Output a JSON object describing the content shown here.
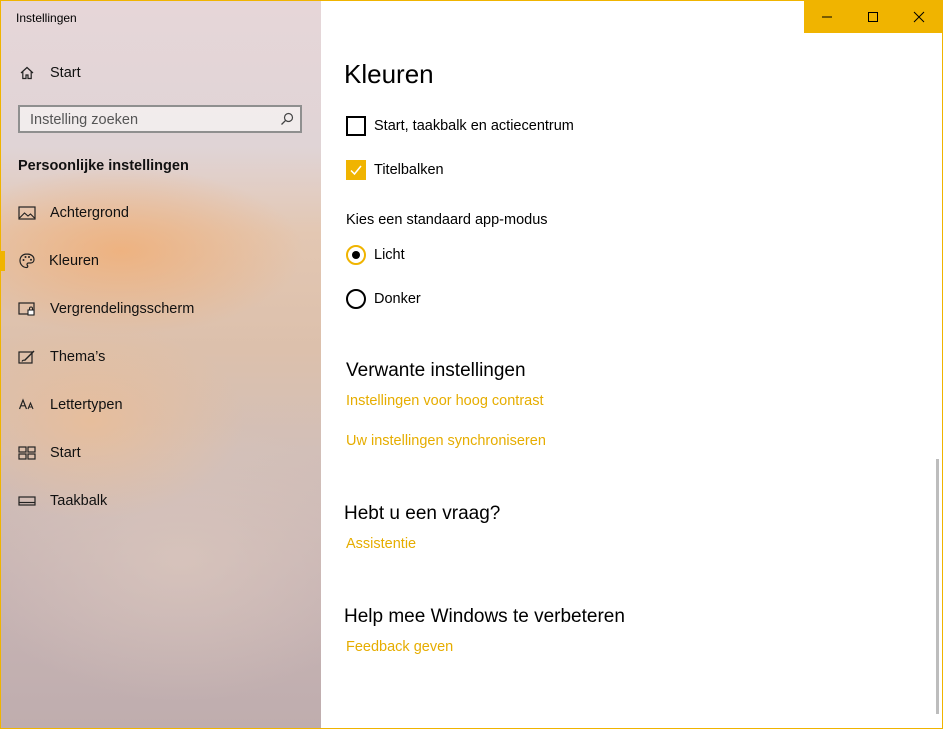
{
  "window": {
    "title": "Instellingen",
    "accent": "#f0b400"
  },
  "sidebar": {
    "home_label": "Start",
    "search_placeholder": "Instelling zoeken",
    "section_heading": "Persoonlijke instellingen",
    "items": [
      {
        "label": "Achtergrond",
        "icon": "picture-icon"
      },
      {
        "label": "Kleuren",
        "icon": "palette-icon",
        "active": true
      },
      {
        "label": "Vergrendelingsscherm",
        "icon": "lock-screen-icon"
      },
      {
        "label": "Thema’s",
        "icon": "theme-brush-icon"
      },
      {
        "label": "Lettertypen",
        "icon": "font-icon"
      },
      {
        "label": "Start",
        "icon": "start-tiles-icon"
      },
      {
        "label": "Taakbalk",
        "icon": "taskbar-icon"
      }
    ]
  },
  "main": {
    "title": "Kleuren",
    "checkboxes": [
      {
        "label": "Start, taakbalk en actiecentrum",
        "checked": false
      },
      {
        "label": "Titelbalken",
        "checked": true
      }
    ],
    "app_mode_heading": "Kies een standaard app-modus",
    "app_modes": [
      {
        "label": "Licht",
        "selected": true
      },
      {
        "label": "Donker",
        "selected": false
      }
    ],
    "related": {
      "heading": "Verwante instellingen",
      "links": [
        "Instellingen voor hoog contrast",
        "Uw instellingen synchroniseren"
      ]
    },
    "question": {
      "heading": "Hebt u een vraag?",
      "link": "Assistentie"
    },
    "improve": {
      "heading": "Help mee Windows te verbeteren",
      "link": "Feedback geven"
    }
  }
}
